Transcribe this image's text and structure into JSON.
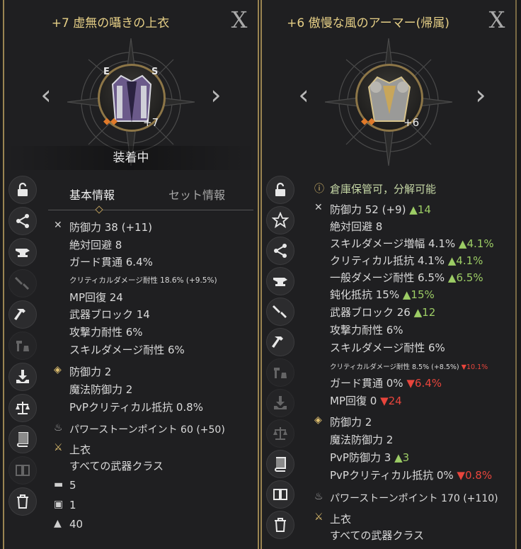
{
  "left": {
    "title": "+7 虚無の囁きの上衣",
    "enhance": "+7",
    "rune_e": "E",
    "rune_s": "S",
    "equipped": "装着中",
    "tab_basic": "基本情報",
    "tab_set": "セット情報",
    "stats": {
      "def": "防御力 38 (+11)",
      "evade": "絶対回避 8",
      "guardpen": "ガード貫通 6.4%",
      "critres": "クリティカルダメージ耐性 18.6% (+9.5%)",
      "mp": "MP回復 24",
      "block": "武器ブロック 14",
      "atkres": "攻撃力耐性 6%",
      "skillres": "スキルダメージ耐性 6%"
    },
    "sub": {
      "def": "防御力 2",
      "mdef": "魔法防御力 2",
      "pvpcrit": "PvPクリティカル抵抗 0.8%"
    },
    "power": "パワーストーンポイント 60 (+50)",
    "slot": "上衣",
    "cls": "すべての武器クラス",
    "anvil": "5",
    "copies": "1",
    "weight": "40"
  },
  "right": {
    "title": "+6 傲慢な風のアーマー(帰属)",
    "enhance": "+6",
    "info": "倉庫保管可，分解可能",
    "stats": {
      "def": "防御力 52 (+9)",
      "def_up": "▲14",
      "evade": "絶対回避 8",
      "skillamp": "スキルダメージ増幅 4.1%",
      "skillamp_up": "▲4.1%",
      "critres": "クリティカル抵抗 4.1%",
      "critres_up": "▲4.1%",
      "normres": "一般ダメージ耐性 6.5%",
      "normres_up": "▲6.5%",
      "slow": "鈍化抵抗 15%",
      "slow_up": "▲15%",
      "block": "武器ブロック 26",
      "block_up": "▲12",
      "atkres": "攻撃力耐性 6%",
      "skillres": "スキルダメージ耐性 6%",
      "critdmg": "クリティカルダメージ耐性 8.5% (+8.5%)",
      "critdmg_dn": "▼10.1%",
      "guardpen": "ガード貫通 0%",
      "guardpen_dn": "▼6.4%",
      "mp": "MP回復 0",
      "mp_dn": "▼24"
    },
    "sub": {
      "def": "防御力 2",
      "mdef": "魔法防御力 2",
      "pvpdef": "PvP防御力 3",
      "pvpdef_up": "▲3",
      "pvpcrit": "PvPクリティカル抵抗 0%",
      "pvpcrit_dn": "▼0.8%"
    },
    "power": "パワーストーンポイント 170 (+110)",
    "slot": "上衣",
    "cls": "すべての武器クラス"
  },
  "colors": {
    "gold": "#e6cf86",
    "up": "#9ccc65",
    "down": "#e8453c",
    "frame": "#9a8452"
  },
  "icons": [
    "lock-icon",
    "share-icon",
    "anvil-icon",
    "sword-break-icon",
    "hammer-icon",
    "craft-icon",
    "extract-icon",
    "scale-icon",
    "book-icon",
    "split-icon",
    "trash-icon",
    "star-icon"
  ]
}
